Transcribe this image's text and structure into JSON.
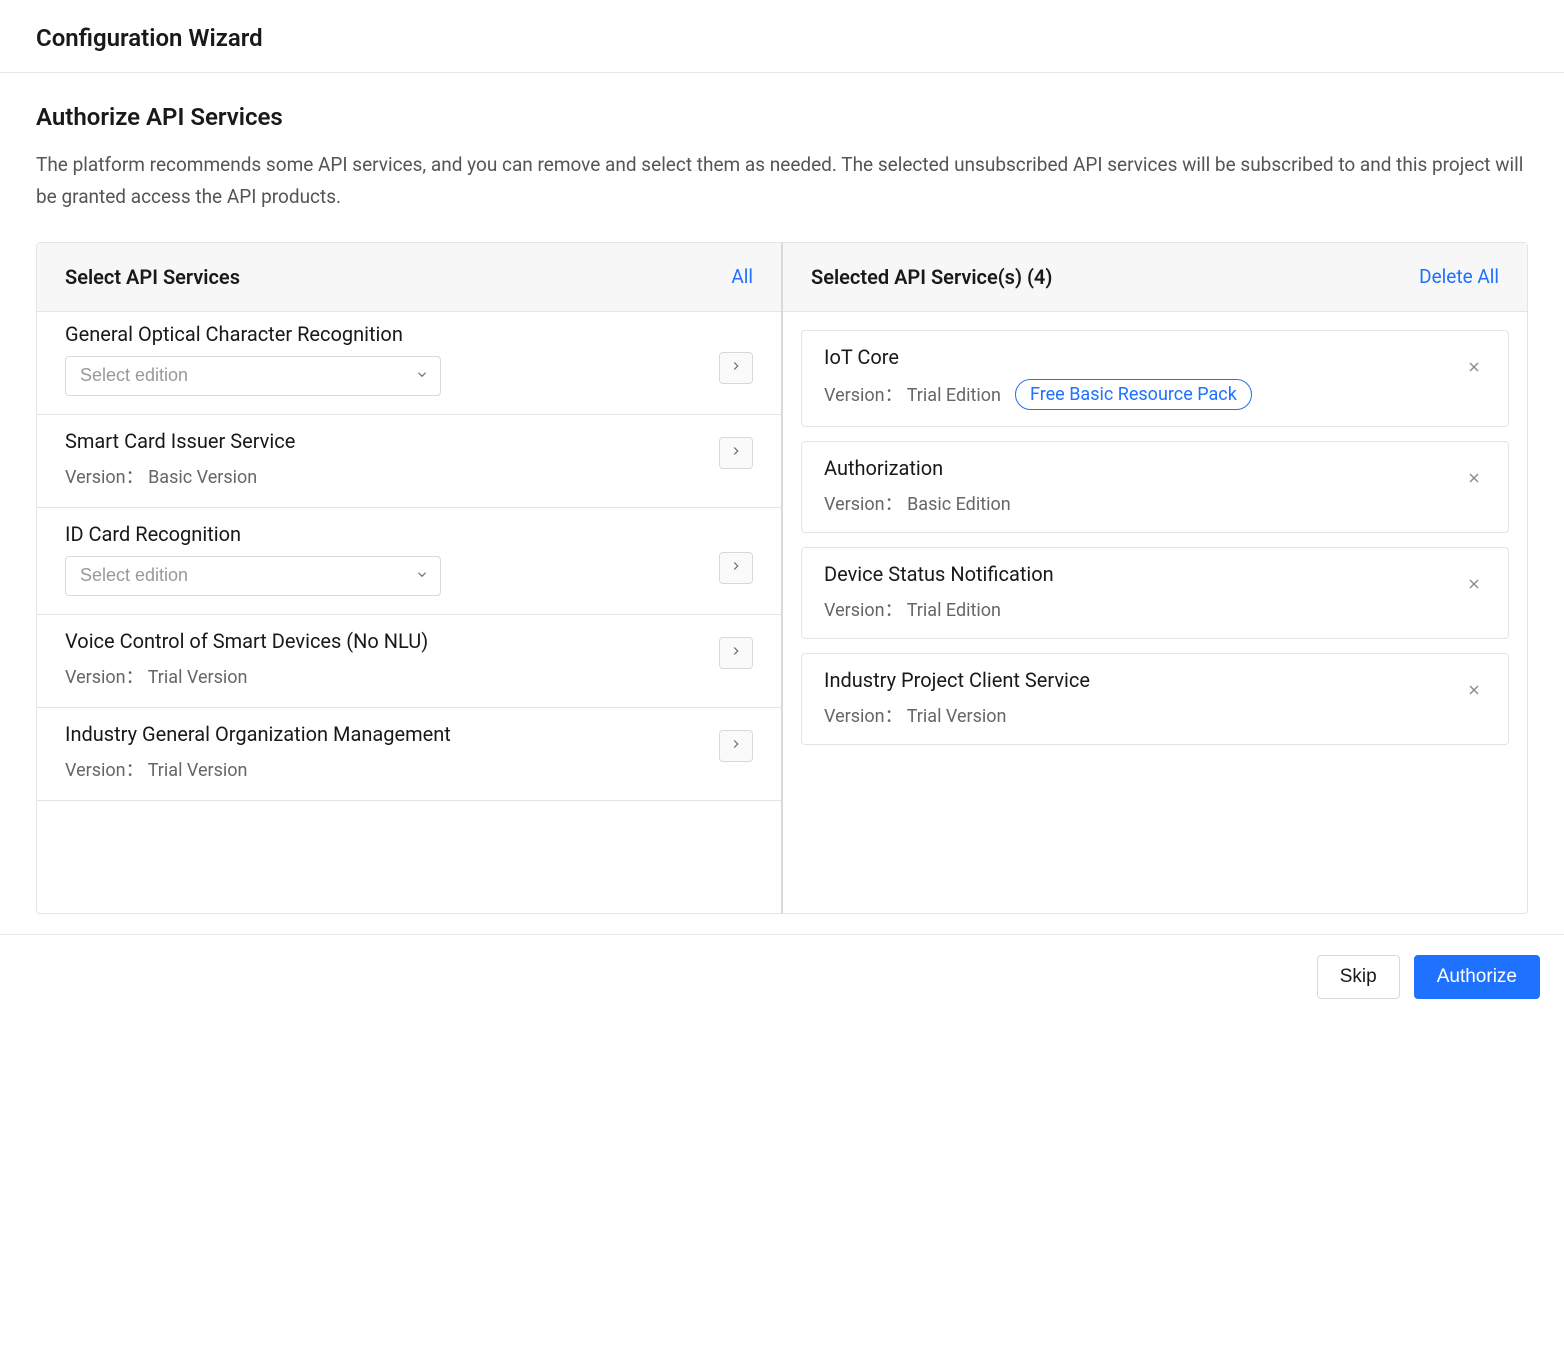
{
  "header": {
    "title": "Configuration Wizard"
  },
  "section": {
    "title": "Authorize API Services",
    "description": "The platform recommends some API services, and you can remove and select them as needed. The selected unsubscribed API services will be subscribed to and this project will be granted access the API products."
  },
  "left": {
    "title": "Select API Services",
    "action": "All",
    "select_placeholder": "Select edition",
    "version_label_prefix": "Version：",
    "items": [
      {
        "name": "General Optical Character Recognition",
        "needs_edition": true
      },
      {
        "name": "Smart Card Issuer Service",
        "needs_edition": false,
        "version": "Basic Version"
      },
      {
        "name": "ID Card Recognition",
        "needs_edition": true
      },
      {
        "name": "Voice Control of Smart Devices (No NLU)",
        "needs_edition": false,
        "version": "Trial Version"
      },
      {
        "name": "Industry General Organization Management",
        "needs_edition": false,
        "version": "Trial Version"
      }
    ]
  },
  "right": {
    "title": "Selected API Service(s) (4)",
    "action": "Delete All",
    "version_label_prefix": "Version：",
    "items": [
      {
        "name": "IoT Core",
        "version": "Trial Edition",
        "badge": "Free Basic Resource Pack"
      },
      {
        "name": "Authorization",
        "version": "Basic Edition"
      },
      {
        "name": "Device Status Notification",
        "version": "Trial Edition"
      },
      {
        "name": "Industry Project Client Service",
        "version": "Trial Version"
      }
    ]
  },
  "footer": {
    "skip": "Skip",
    "authorize": "Authorize"
  }
}
